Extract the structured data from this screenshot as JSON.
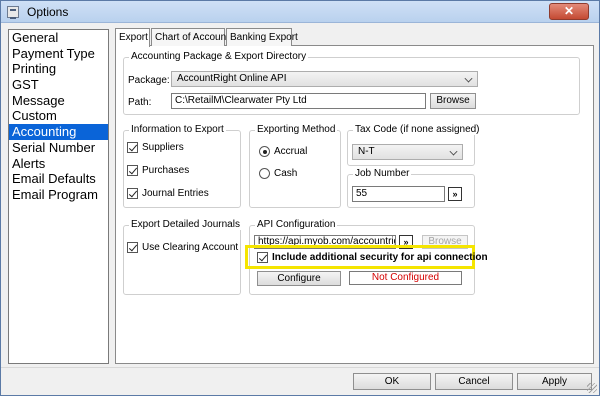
{
  "window": {
    "title": "Options",
    "close_glyph": "✕"
  },
  "sidebar": {
    "items": [
      {
        "label": "General"
      },
      {
        "label": "Payment Type"
      },
      {
        "label": "Printing"
      },
      {
        "label": "GST"
      },
      {
        "label": "Message"
      },
      {
        "label": "Custom"
      },
      {
        "label": "Accounting",
        "selected": true
      },
      {
        "label": "Serial Number"
      },
      {
        "label": "Alerts"
      },
      {
        "label": "Email Defaults"
      },
      {
        "label": "Email Program"
      }
    ]
  },
  "tabs": [
    {
      "label": "Export",
      "active": true
    },
    {
      "label": "Chart of Accounts"
    },
    {
      "label": "Banking Export"
    }
  ],
  "accounting_package": {
    "legend": "Accounting Package & Export Directory",
    "package_label": "Package:",
    "package_value": "AccountRight Online API",
    "path_label": "Path:",
    "path_value": "C:\\RetailM\\Clearwater Pty Ltd",
    "browse_label": "Browse"
  },
  "info_export": {
    "legend": "Information to Export",
    "suppliers": {
      "label": "Suppliers",
      "checked": true
    },
    "purchases": {
      "label": "Purchases",
      "checked": true
    },
    "journal_entries": {
      "label": "Journal Entries",
      "checked": true
    }
  },
  "exporting_method": {
    "legend": "Exporting Method",
    "accrual": {
      "label": "Accrual",
      "selected": true
    },
    "cash": {
      "label": "Cash",
      "selected": false
    }
  },
  "tax_code": {
    "legend": "Tax Code (if none assigned)",
    "value": "N-T"
  },
  "job_number": {
    "legend": "Job Number",
    "value": "55",
    "picker_label": "»"
  },
  "export_journals": {
    "legend": "Export Detailed Journals",
    "use_clearing": {
      "label": "Use Clearing Account",
      "checked": true
    }
  },
  "api_config": {
    "legend": "API Configuration",
    "url_value": "https://api.myob.com/accountright/",
    "picker_label": "»",
    "browse_label": "Browse",
    "security": {
      "label": "Include additional security for api connection",
      "checked": true
    },
    "configure_label": "Configure",
    "status": "Not Configured",
    "status_color": "#d40000",
    "highlight_color": "#f5e500"
  },
  "footer": {
    "ok": "OK",
    "cancel": "Cancel",
    "apply": "Apply"
  }
}
